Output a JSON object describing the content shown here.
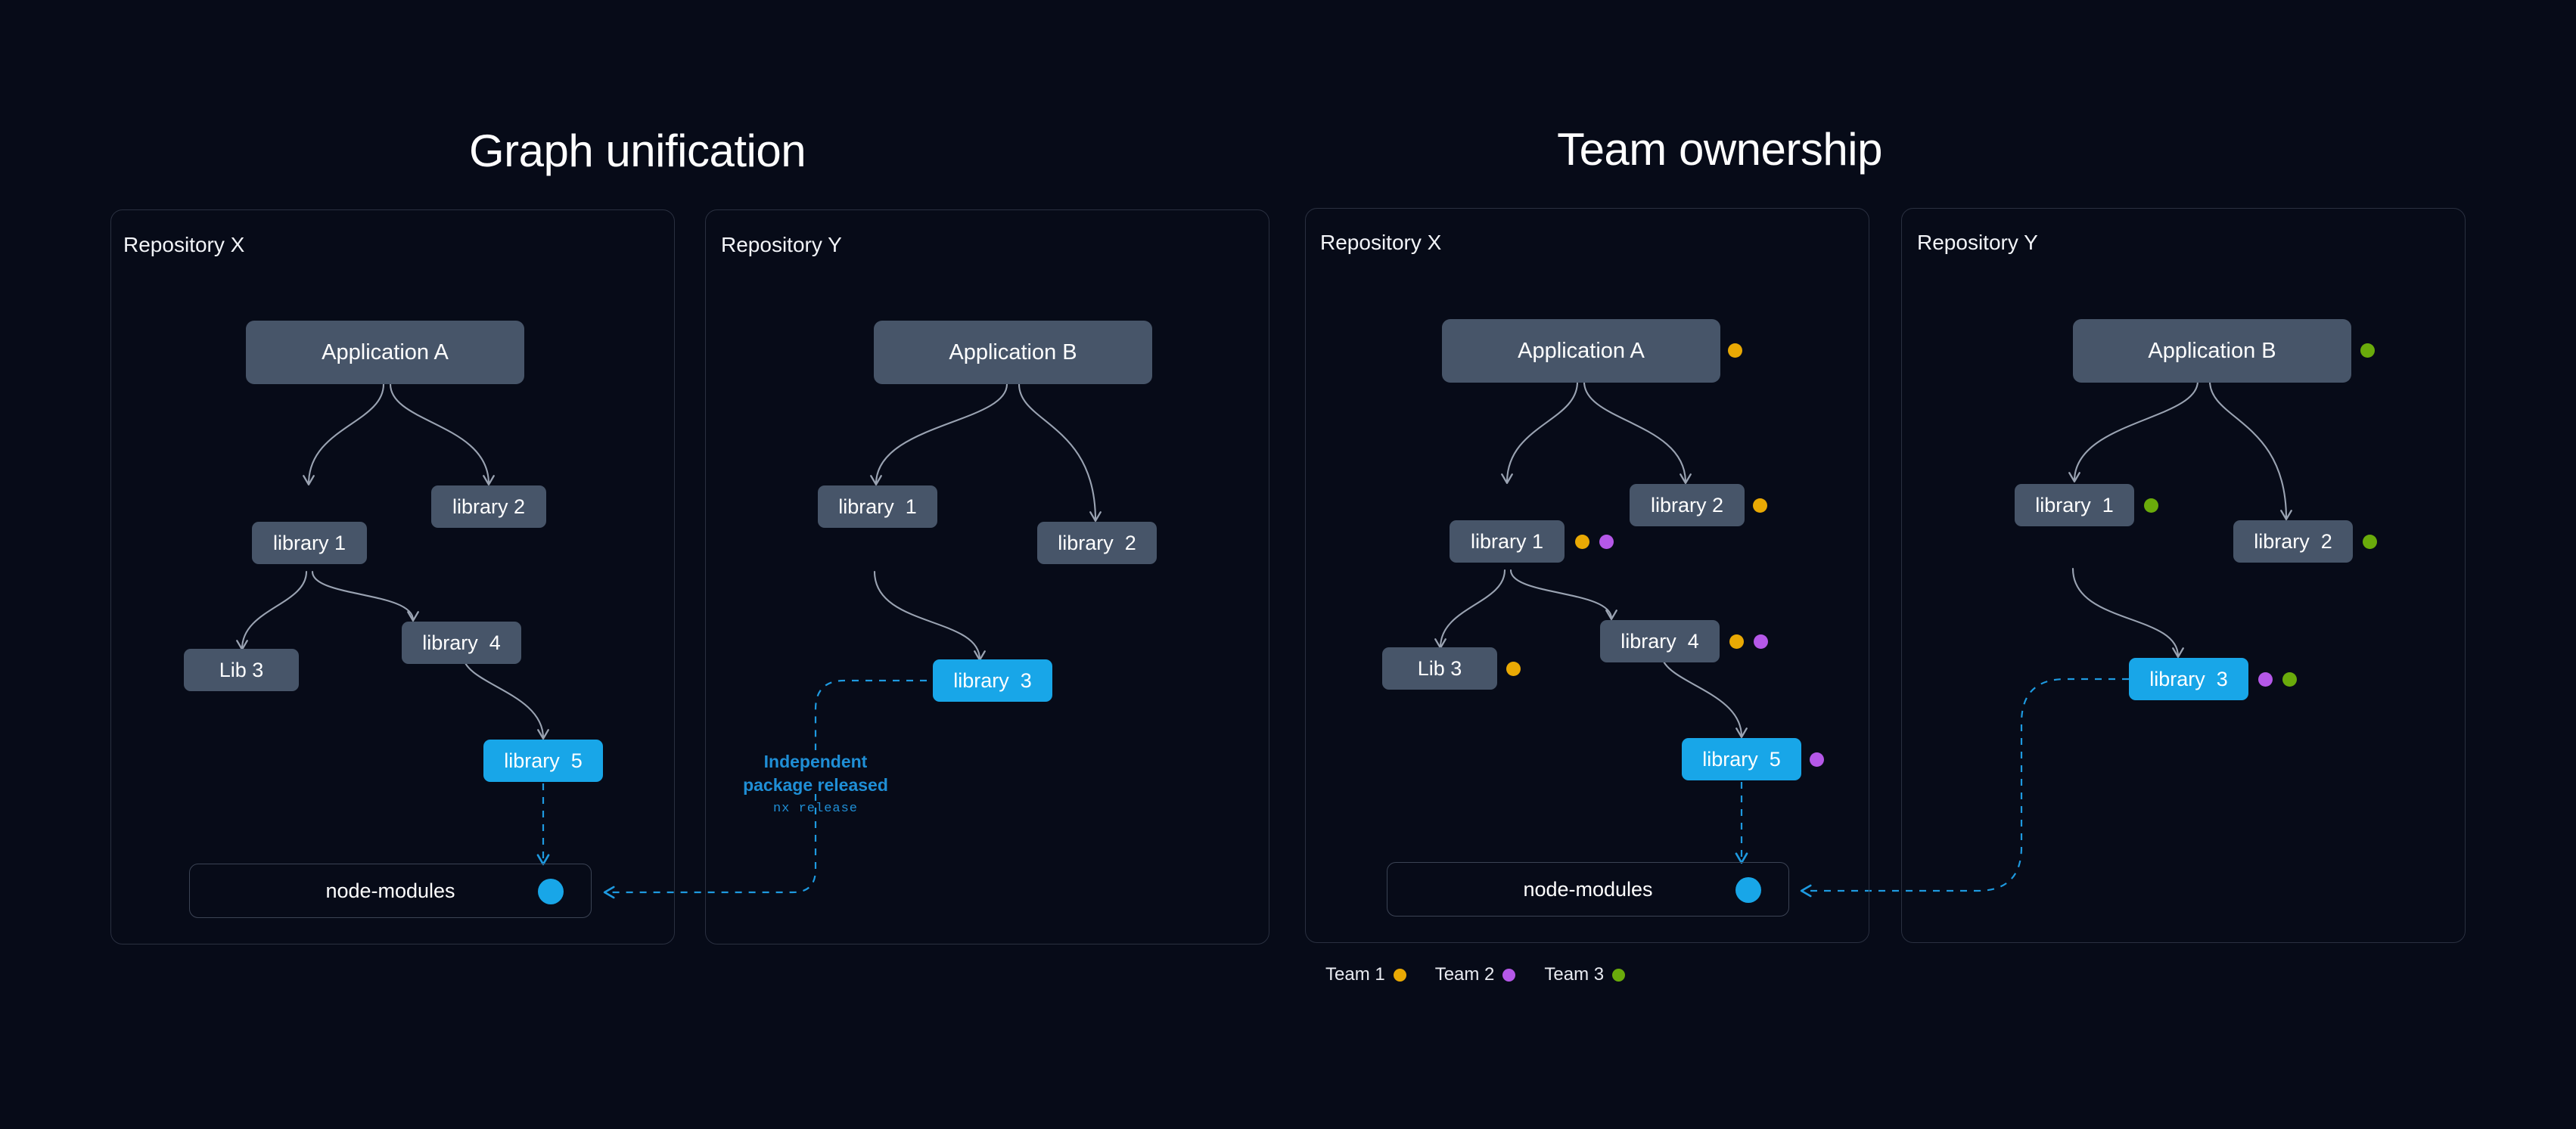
{
  "page": {
    "background_color": "#070b18"
  },
  "sections": [
    {
      "id": "graph-unification",
      "title": "Graph unification"
    },
    {
      "id": "team-ownership",
      "title": "Team ownership"
    }
  ],
  "colors": {
    "node_gray": "#475569",
    "node_blue": "#18a6e8",
    "edge_gray": "#9aa3b2",
    "edge_blue": "#1e9ae0",
    "panel_border": "#2a3040",
    "team_1": "#e9a904",
    "team_2": "#b558e8",
    "team_3": "#6aab0b",
    "text": "#ffffff"
  },
  "panels": [
    {
      "id": "left-repo-x",
      "label": "Repository X"
    },
    {
      "id": "left-repo-y",
      "label": "Repository Y"
    },
    {
      "id": "right-repo-x",
      "label": "Repository X"
    },
    {
      "id": "right-repo-y",
      "label": "Repository Y"
    }
  ],
  "nodes": {
    "left_repo_x": [
      {
        "id": "app-a",
        "label": "Application A",
        "kind": "app"
      },
      {
        "id": "library2",
        "label": "library 2",
        "kind": "lib"
      },
      {
        "id": "library1",
        "label": "library 1",
        "kind": "lib"
      },
      {
        "id": "lib3",
        "label": "Lib 3",
        "kind": "lib"
      },
      {
        "id": "library4",
        "label": "library  4",
        "kind": "lib"
      },
      {
        "id": "library5",
        "label": "library  5",
        "kind": "published"
      },
      {
        "id": "node-modules",
        "label": "node-modules",
        "kind": "container"
      }
    ],
    "left_repo_y": [
      {
        "id": "app-b",
        "label": "Application B",
        "kind": "app"
      },
      {
        "id": "library1",
        "label": "library  1",
        "kind": "lib"
      },
      {
        "id": "library2",
        "label": "library  2",
        "kind": "lib"
      },
      {
        "id": "library3",
        "label": "library  3",
        "kind": "published"
      }
    ],
    "right_repo_x": [
      {
        "id": "app-a",
        "label": "Application A",
        "kind": "app",
        "teams": [
          "team_1"
        ]
      },
      {
        "id": "library2",
        "label": "library 2",
        "kind": "lib",
        "teams": [
          "team_1"
        ]
      },
      {
        "id": "library1",
        "label": "library 1",
        "kind": "lib",
        "teams": [
          "team_1",
          "team_2"
        ]
      },
      {
        "id": "lib3",
        "label": "Lib 3",
        "kind": "lib",
        "teams": [
          "team_1"
        ]
      },
      {
        "id": "library4",
        "label": "library  4",
        "kind": "lib",
        "teams": [
          "team_1",
          "team_2"
        ]
      },
      {
        "id": "library5",
        "label": "library  5",
        "kind": "published",
        "teams": [
          "team_2"
        ]
      },
      {
        "id": "node-modules",
        "label": "node-modules",
        "kind": "container"
      }
    ],
    "right_repo_y": [
      {
        "id": "app-b",
        "label": "Application B",
        "kind": "app",
        "teams": [
          "team_3"
        ]
      },
      {
        "id": "library1",
        "label": "library  1",
        "kind": "lib",
        "teams": [
          "team_3"
        ]
      },
      {
        "id": "library2",
        "label": "library  2",
        "kind": "lib",
        "teams": [
          "team_3"
        ]
      },
      {
        "id": "library3",
        "label": "library  3",
        "kind": "published",
        "teams": [
          "team_2",
          "team_3"
        ]
      }
    ]
  },
  "annotation": {
    "title": "Independent\npackage released",
    "command": "nx release"
  },
  "legend": {
    "items": [
      {
        "label": "Team 1",
        "color": "#e9a904"
      },
      {
        "label": "Team 2",
        "color": "#b558e8"
      },
      {
        "label": "Team 3",
        "color": "#6aab0b"
      }
    ]
  }
}
